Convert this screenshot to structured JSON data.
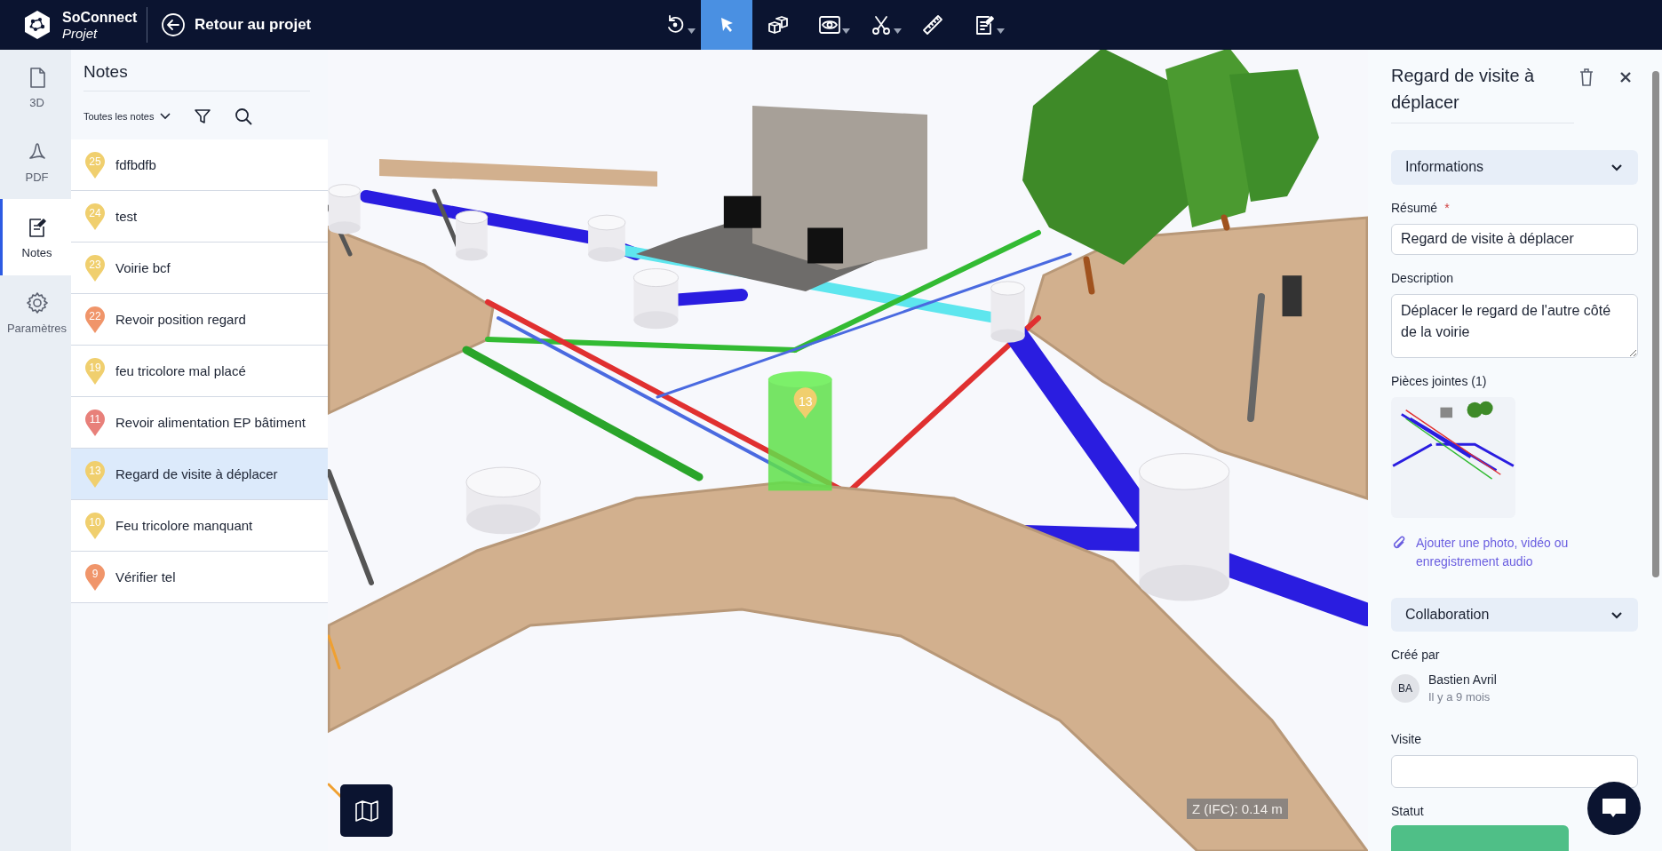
{
  "header": {
    "logo_title": "SoConnect",
    "logo_subtitle": "Projet",
    "back_label": "Retour au projet"
  },
  "toolbar": [
    {
      "kind": "rotate",
      "selected": false,
      "dropdown": true
    },
    {
      "kind": "pointer",
      "selected": true,
      "dropdown": false
    },
    {
      "kind": "cubes",
      "selected": false,
      "dropdown": false
    },
    {
      "kind": "eye",
      "selected": false,
      "dropdown": true
    },
    {
      "kind": "scissors",
      "selected": false,
      "dropdown": true
    },
    {
      "kind": "ruler",
      "selected": false,
      "dropdown": false
    },
    {
      "kind": "note",
      "selected": false,
      "dropdown": true
    }
  ],
  "rail": [
    {
      "kind": "document",
      "label": "3D",
      "selected": false
    },
    {
      "kind": "pdf",
      "label": "PDF",
      "selected": false
    },
    {
      "kind": "note",
      "label": "Notes",
      "selected": true
    },
    {
      "kind": "settings",
      "label": "Paramètres",
      "selected": false
    }
  ],
  "notes_panel": {
    "title": "Notes",
    "filter": "Toutes les notes",
    "notes": [
      {
        "number": "25",
        "title": "fdfbdfb",
        "color": "#f0cf6e",
        "selected": false
      },
      {
        "number": "24",
        "title": "test",
        "color": "#f0cf6e",
        "selected": false
      },
      {
        "number": "23",
        "title": "Voirie bcf",
        "color": "#f0cf6e",
        "selected": false
      },
      {
        "number": "22",
        "title": "Revoir position regard",
        "color": "#f0956a",
        "selected": false
      },
      {
        "number": "19",
        "title": "feu tricolore mal placé",
        "color": "#f0cf6e",
        "selected": false
      },
      {
        "number": "11",
        "title": "Revoir alimentation EP bâtiment",
        "color": "#e8807a",
        "selected": false
      },
      {
        "number": "13",
        "title": "Regard de visite à déplacer",
        "color": "#f0cf6e",
        "selected": true
      },
      {
        "number": "10",
        "title": "Feu tricolore manquant",
        "color": "#f0cf6e",
        "selected": false
      },
      {
        "number": "9",
        "title": "Vérifier tel",
        "color": "#f0956a",
        "selected": false
      }
    ]
  },
  "viewport": {
    "marker": "13",
    "z_reading": "Z (IFC): 0.14 m"
  },
  "detail": {
    "title": "Regard de visite à déplacer",
    "informations": {
      "label": "Informations",
      "expanded": true
    },
    "summary": {
      "label": "Résumé",
      "required_mark": "*",
      "value": "Regard de visite à déplacer"
    },
    "description": {
      "label": "Description",
      "value": "Déplacer le regard de l'autre côté de la voirie"
    },
    "attachments": {
      "label": "Pièces jointes (1)",
      "add_link": "Ajouter une photo, vidéo ou enregistrement audio"
    },
    "collaboration": {
      "label": "Collaboration",
      "expanded": true
    },
    "created_by": {
      "label": "Créé par",
      "initials": "BA",
      "name": "Bastien Avril",
      "time": "Il y a 9 mois"
    },
    "visit": {
      "label": "Visite"
    },
    "status": {
      "label": "Statut"
    }
  }
}
